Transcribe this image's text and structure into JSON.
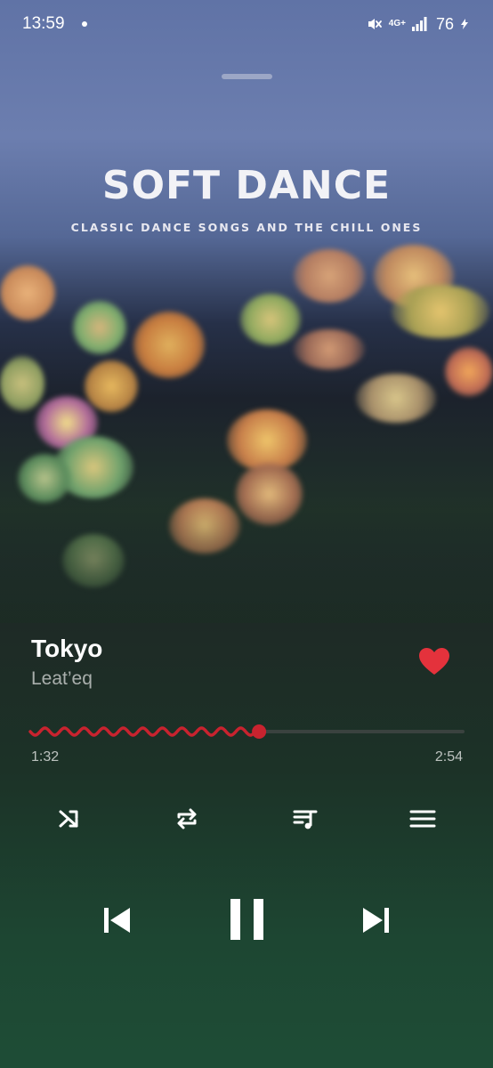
{
  "status_bar": {
    "time": "13:59",
    "network": "4G+",
    "battery": "76",
    "icons": [
      "mute-icon",
      "signal-icon",
      "charging-icon"
    ]
  },
  "album": {
    "title": "SOFT DANCE",
    "subtitle": "CLASSIC DANCE SONGS AND THE CHILL ONES"
  },
  "track": {
    "title": "Tokyo",
    "artist": "Leat’eq",
    "liked": true
  },
  "progress": {
    "current": "1:32",
    "total": "2:54",
    "fraction": 0.529
  },
  "controls": {
    "secondary": [
      "shuffle-icon",
      "repeat-icon",
      "lyrics-queue-icon",
      "menu-icon"
    ],
    "transport": [
      "previous-icon",
      "pause-icon",
      "next-icon"
    ]
  },
  "colors": {
    "accent": "#e0323c",
    "progress_played": "#c8232f",
    "progress_track": "#3a423f"
  }
}
